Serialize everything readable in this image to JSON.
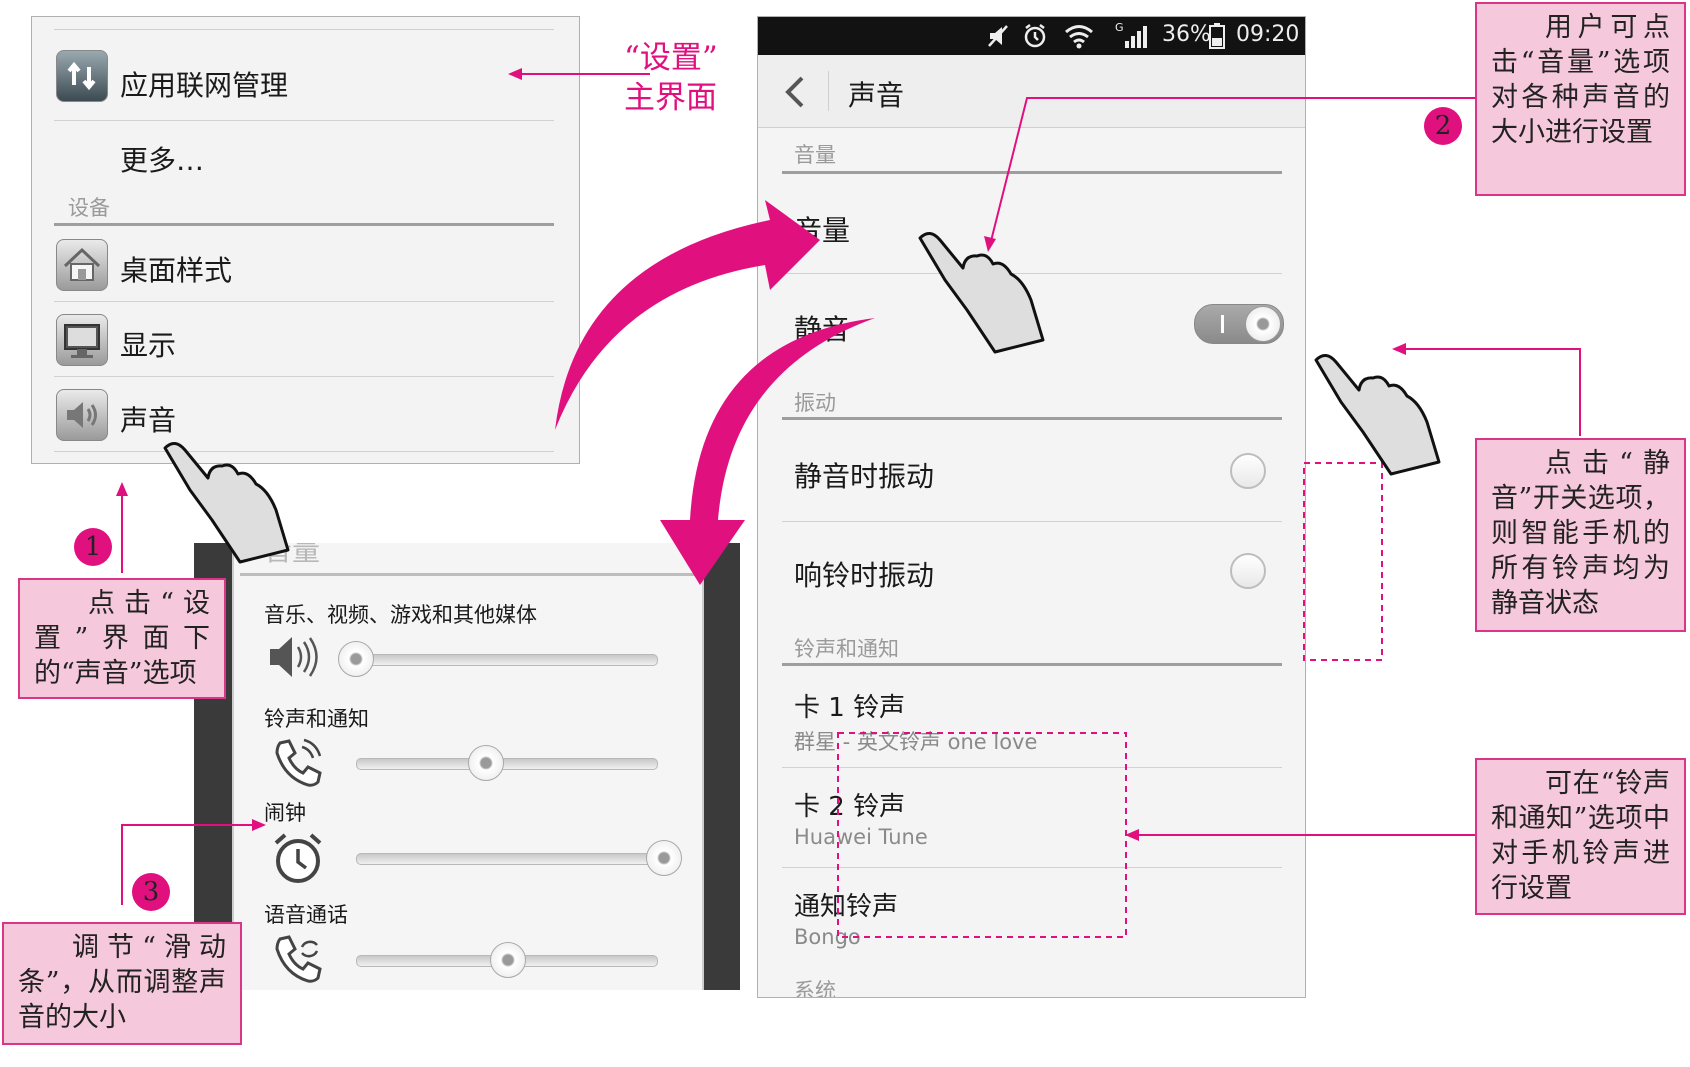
{
  "settings_main": {
    "items": [
      {
        "label": "应用联网管理",
        "icon": "network-sync-icon"
      },
      {
        "label": "更多…"
      },
      {
        "label": "设备",
        "section": true
      },
      {
        "label": "桌面样式",
        "icon": "home-icon"
      },
      {
        "label": "显示",
        "icon": "monitor-icon"
      },
      {
        "label": "声音",
        "icon": "speaker-icon"
      }
    ]
  },
  "callout_main": "“设置”\n主界面",
  "sound_screen": {
    "status_bar": {
      "signal_label": "G",
      "battery": "36%",
      "time": "09:20"
    },
    "title": "声音",
    "sections": {
      "volume": "音量",
      "vibrate": "振动",
      "ringtone": "铃声和通知",
      "system": "系统"
    },
    "volume_item": "音量",
    "mute_item": "静音",
    "vibrate_silent": "静音时振动",
    "vibrate_ring": "响铃时振动",
    "sim1": {
      "label": "卡 1 铃声",
      "value": "群星 - 英文铃声 one love"
    },
    "sim2": {
      "label": "卡 2 铃声",
      "value": "Huawei Tune"
    },
    "notify": {
      "label": "通知铃声",
      "value": "Bongo"
    },
    "mute_on": true
  },
  "volume_dialog": {
    "header": "音量",
    "rows": [
      {
        "label": "音乐、视频、游戏和其他媒体",
        "icon": "speaker-icon",
        "level": 0.0
      },
      {
        "label": "铃声和通知",
        "icon": "phone-icon",
        "level": 0.42
      },
      {
        "label": "闹钟",
        "icon": "alarm-clock-icon",
        "level": 1.0
      },
      {
        "label": "语音通话",
        "icon": "phone-sync-icon",
        "level": 0.5
      }
    ]
  },
  "notes": {
    "n1": "点击“设置”界面下的“声音”选项",
    "n2": "用户可点击“音量”选项对各种声音的大小进行设置",
    "n3": "调节“滑动条”，从而调整声音的大小",
    "n4": "点击“静音”开关选项，则智能手机的所有铃声均为静音状态",
    "n5": "可在“铃声和通知”选项中对手机铃声进行设置"
  },
  "badges": [
    "1",
    "2",
    "3"
  ],
  "colors": {
    "accent": "#e0117f",
    "note_bg": "#f6c8dc"
  }
}
